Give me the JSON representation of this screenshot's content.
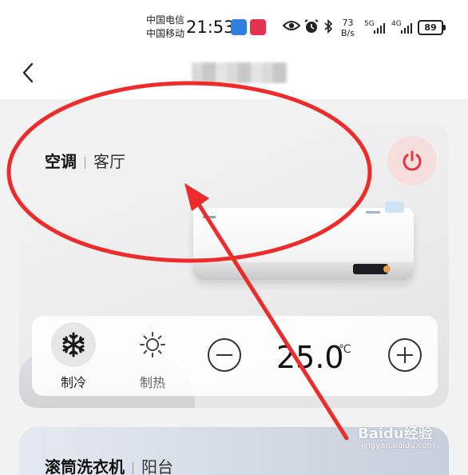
{
  "status_bar": {
    "carrier_1": "中国电信",
    "carrier_2": "中国移动",
    "time": "21:53",
    "net_speed_value": "73",
    "net_speed_unit": "B/s",
    "signal_1": "5G",
    "signal_2": "4G",
    "battery": "89"
  },
  "header": {
    "back_icon": "chevron-left-icon"
  },
  "device_card": {
    "device_name": "空调",
    "room": "客厅",
    "power_icon": "power-icon",
    "power_color": "#e8343a",
    "modes": [
      {
        "label": "制冷",
        "icon": "snowflake-icon",
        "selected": true
      },
      {
        "label": "制热",
        "icon": "sun-icon",
        "selected": false
      }
    ],
    "temperature": "25.0",
    "temperature_unit": "℃"
  },
  "second_card": {
    "device_name": "滚筒洗衣机",
    "room": "阳台"
  },
  "annotation": {
    "color": "#ee2b2b"
  },
  "watermark": {
    "main": "Baidu经验",
    "sub": "jingyan.baidu.com"
  }
}
